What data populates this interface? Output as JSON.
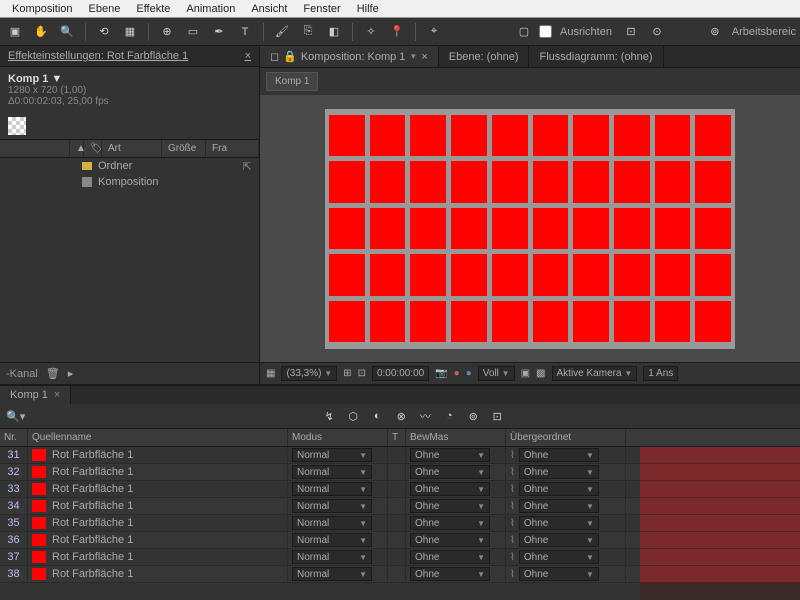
{
  "menu": [
    "Komposition",
    "Ebene",
    "Effekte",
    "Animation",
    "Ansicht",
    "Fenster",
    "Hilfe"
  ],
  "toolbar": {
    "align_label": "Ausrichten",
    "workspace_label": "Arbeitsbereic"
  },
  "effects_panel": {
    "title": "Effekteinstellungen: Rot Farbfläche 1",
    "comp_name": "Komp 1",
    "dimensions": "1280 x 720 (1,00)",
    "duration": "Δ0:00:02:03, 25,00 fps"
  },
  "project": {
    "cols": {
      "sort": "▲",
      "tag": "🏷",
      "type": "Art",
      "size": "Größe",
      "fr": "Fra"
    },
    "items": [
      {
        "name": "Ordner",
        "type": "folder"
      },
      {
        "name": "Komposition",
        "type": "comp"
      }
    ],
    "footer_label": "-Kanal"
  },
  "viewer": {
    "tabs": [
      {
        "label": "Komposition: Komp 1",
        "active": true
      },
      {
        "label": "Ebene: (ohne)",
        "active": false
      },
      {
        "label": "Flussdiagramm: (ohne)",
        "active": false
      }
    ],
    "crumb": "Komp 1",
    "zoom": "(33,3%)",
    "time": "0:00:00:00",
    "view_mode": "Voll",
    "camera": "Aktive Kamera",
    "views": "1 Ans"
  },
  "timeline": {
    "tab": "Komp 1",
    "cols": {
      "nr": "Nr.",
      "name": "Quellenname",
      "mode": "Modus",
      "t": "T",
      "bew": "BewMas",
      "parent": "Übergeordnet"
    },
    "default_mode": "Normal",
    "default_bew": "Ohne",
    "default_parent": "Ohne",
    "layers": [
      {
        "nr": 31,
        "name": "Rot Farbfläche 1"
      },
      {
        "nr": 32,
        "name": "Rot Farbfläche 1"
      },
      {
        "nr": 33,
        "name": "Rot Farbfläche 1"
      },
      {
        "nr": 34,
        "name": "Rot Farbfläche 1"
      },
      {
        "nr": 35,
        "name": "Rot Farbfläche 1"
      },
      {
        "nr": 36,
        "name": "Rot Farbfläche 1"
      },
      {
        "nr": 37,
        "name": "Rot Farbfläche 1"
      },
      {
        "nr": 38,
        "name": "Rot Farbfläche 1"
      }
    ]
  }
}
